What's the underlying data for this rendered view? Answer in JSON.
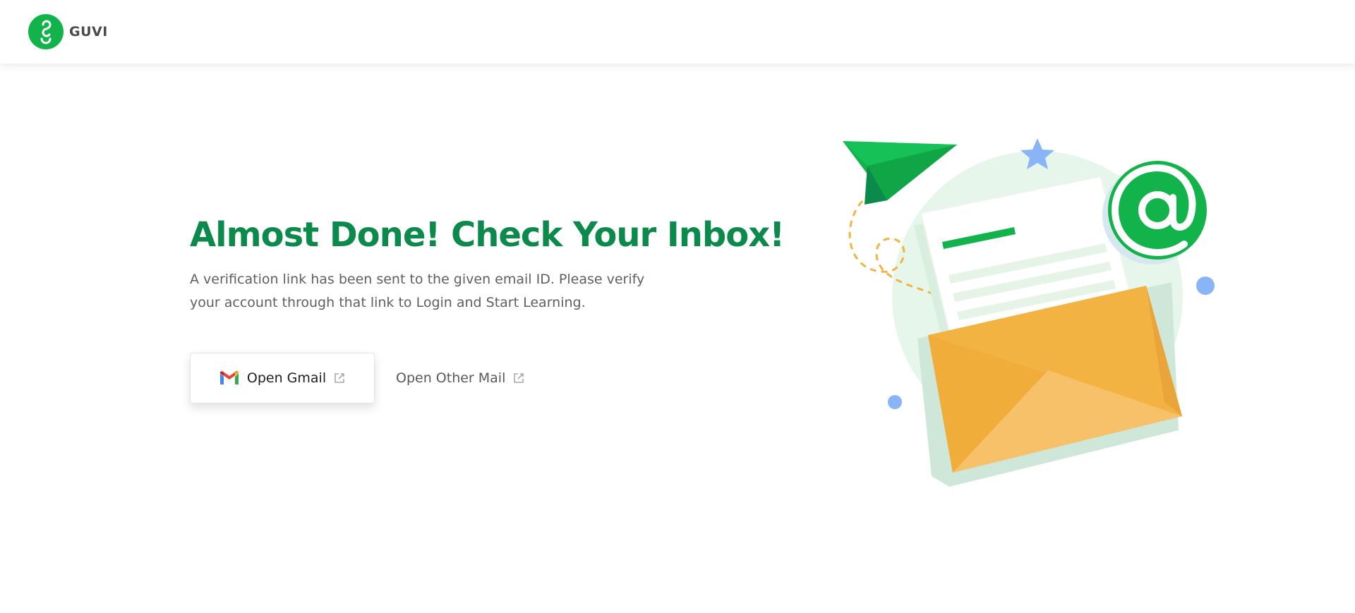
{
  "header": {
    "brand_name": "GUVI",
    "logo_icon": "guvi-logo-icon"
  },
  "main": {
    "headline": "Almost Done! Check Your Inbox!",
    "message": "A verification link has been sent to the given email ID. Please verify your account through that link to Login and Start Learning.",
    "buttons": {
      "open_gmail": {
        "label": "Open Gmail",
        "icon": "gmail-icon",
        "trailing_icon": "external-link-icon"
      },
      "open_other_mail": {
        "label": "Open Other Mail",
        "trailing_icon": "external-link-icon"
      }
    }
  },
  "illustration": {
    "name": "email-envelope-illustration",
    "elements": [
      "paper-plane-icon",
      "star-icon",
      "at-sign-icon",
      "envelope-icon",
      "letter-icon"
    ]
  },
  "colors": {
    "brand_green": "#11b34a",
    "headline_green": "#0b8a4c",
    "envelope_orange": "#f2b343",
    "accent_blue": "#8ab4f8"
  }
}
